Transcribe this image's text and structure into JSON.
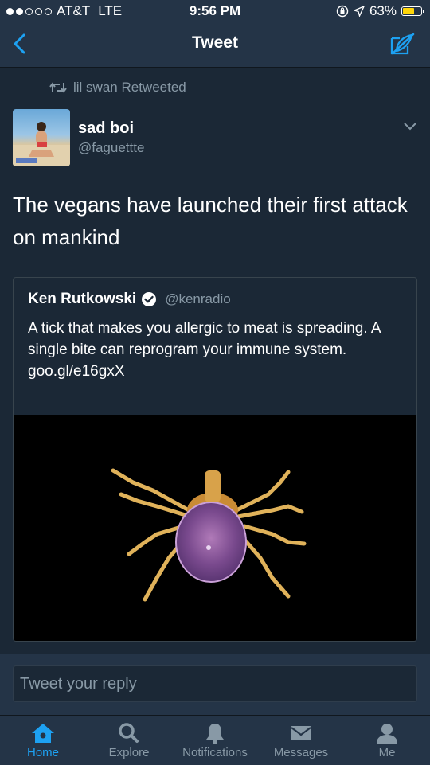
{
  "status_bar": {
    "carrier": "AT&T",
    "network": "LTE",
    "time": "9:56 PM",
    "battery": "63%",
    "battery_level": 0.63
  },
  "nav": {
    "title": "Tweet"
  },
  "retweet_by": "lil swan Retweeted",
  "tweet": {
    "name": "sad boi",
    "handle": "@faguettte",
    "text": "The vegans have launched their first attack on mankind"
  },
  "quoted": {
    "name": "Ken Rutkowski",
    "handle": "@kenradio",
    "text": "A tick that makes you allergic to meat is spreading. A single bite can reprogram your immune system.",
    "link": "goo.gl/e16gxX"
  },
  "reply": {
    "placeholder": "Tweet your reply"
  },
  "tabs": [
    {
      "label": "Home",
      "icon": "home-icon"
    },
    {
      "label": "Explore",
      "icon": "search-icon"
    },
    {
      "label": "Notifications",
      "icon": "bell-icon"
    },
    {
      "label": "Messages",
      "icon": "envelope-icon"
    },
    {
      "label": "Me",
      "icon": "person-icon"
    }
  ],
  "colors": {
    "background": "#1b2836",
    "bar": "#243447",
    "accent": "#1da1f2",
    "secondary_text": "#8899a6",
    "battery": "#ffd60a"
  }
}
